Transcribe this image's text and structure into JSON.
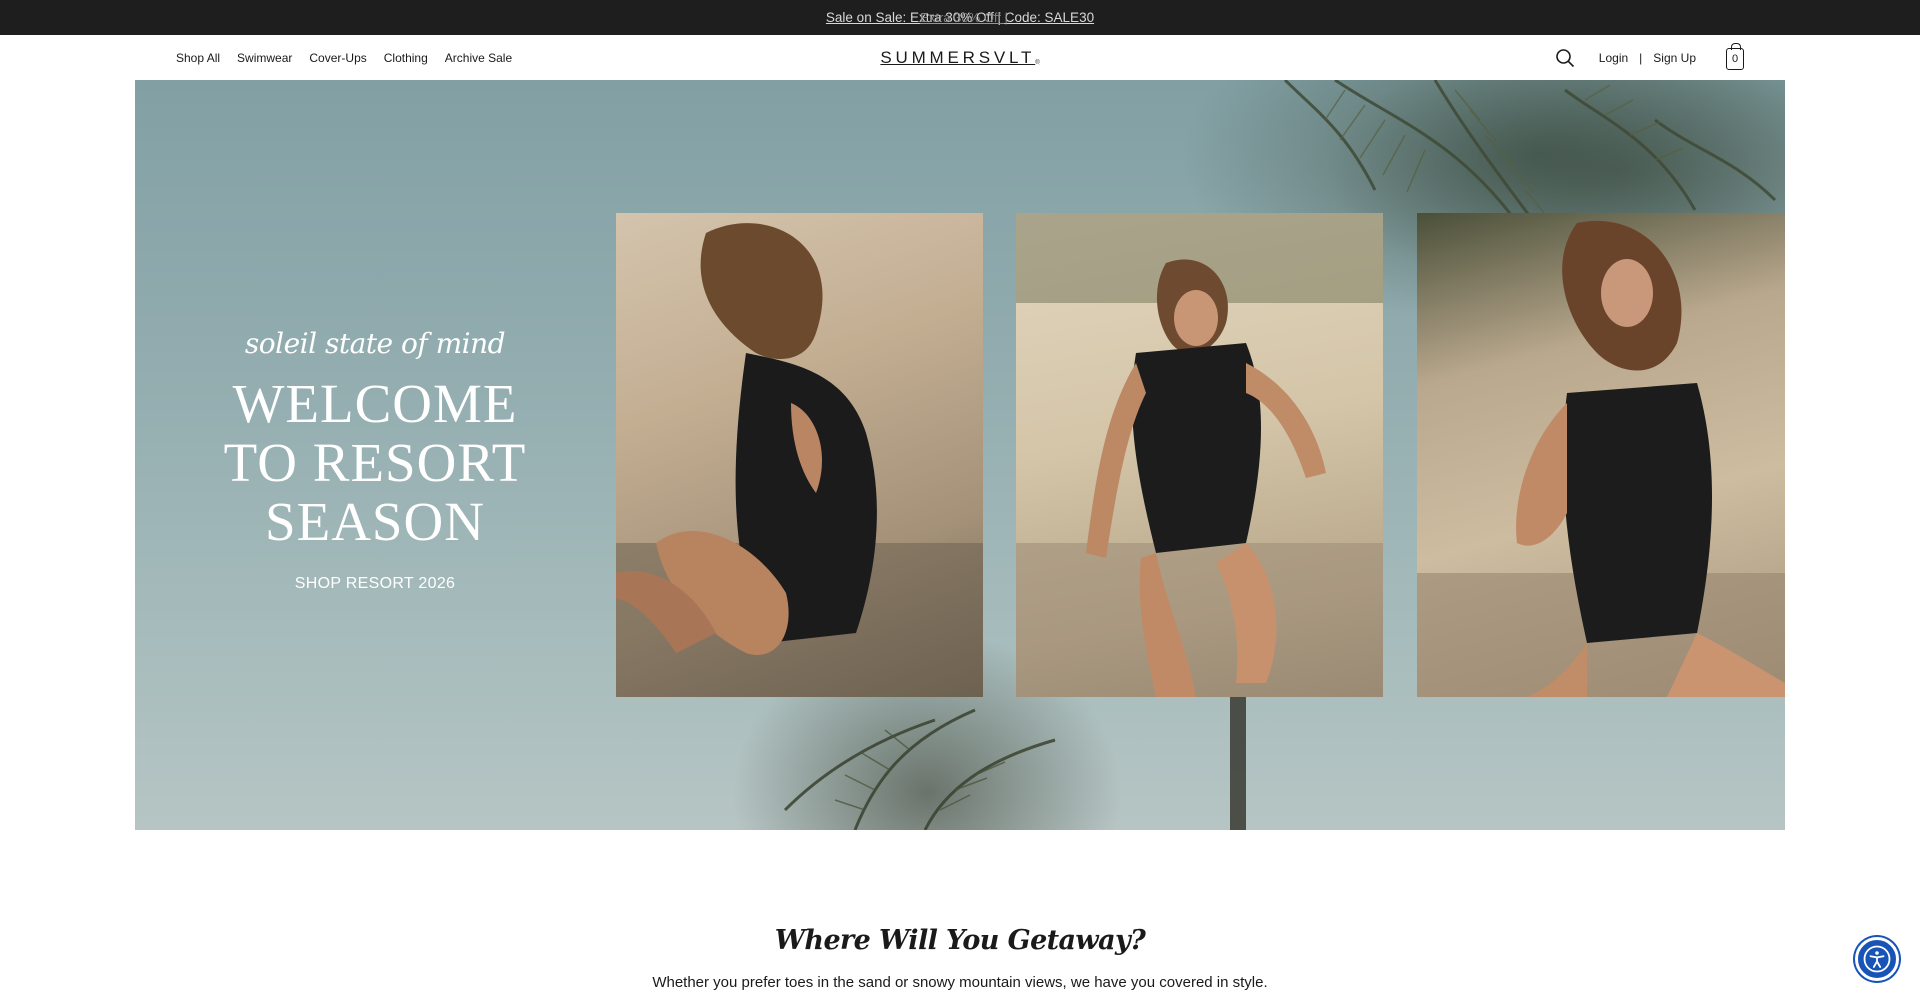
{
  "announcement": {
    "message": "Sale on Sale: Extra 30% Off | Code: SALE30",
    "ghost_message": "Extra 30% Off |"
  },
  "nav": {
    "items": [
      "Shop All",
      "Swimwear",
      "Cover-Ups",
      "Clothing",
      "Archive Sale"
    ]
  },
  "brand": {
    "logo": "SUMMERSVLT",
    "logo_mark": "®"
  },
  "account": {
    "login": "Login",
    "separator": "|",
    "signup": "Sign Up"
  },
  "cart": {
    "count": "0"
  },
  "hero": {
    "eyebrow": "soleil state of mind",
    "headline_line1": "WELCOME",
    "headline_line2": "TO RESORT",
    "headline_line3": "SEASON",
    "cta": "SHOP RESORT 2026"
  },
  "section": {
    "title": "Where Will You Getaway?",
    "subtitle": "Whether you prefer toes in the sand or snowy mountain views, we have you covered in style."
  },
  "icons": {
    "search": "search-icon",
    "cart": "shopping-bag-icon",
    "accessibility": "accessibility-icon"
  },
  "colors": {
    "announcement_bg": "#1e1e1e",
    "accessibility_button": "#1854b8"
  }
}
